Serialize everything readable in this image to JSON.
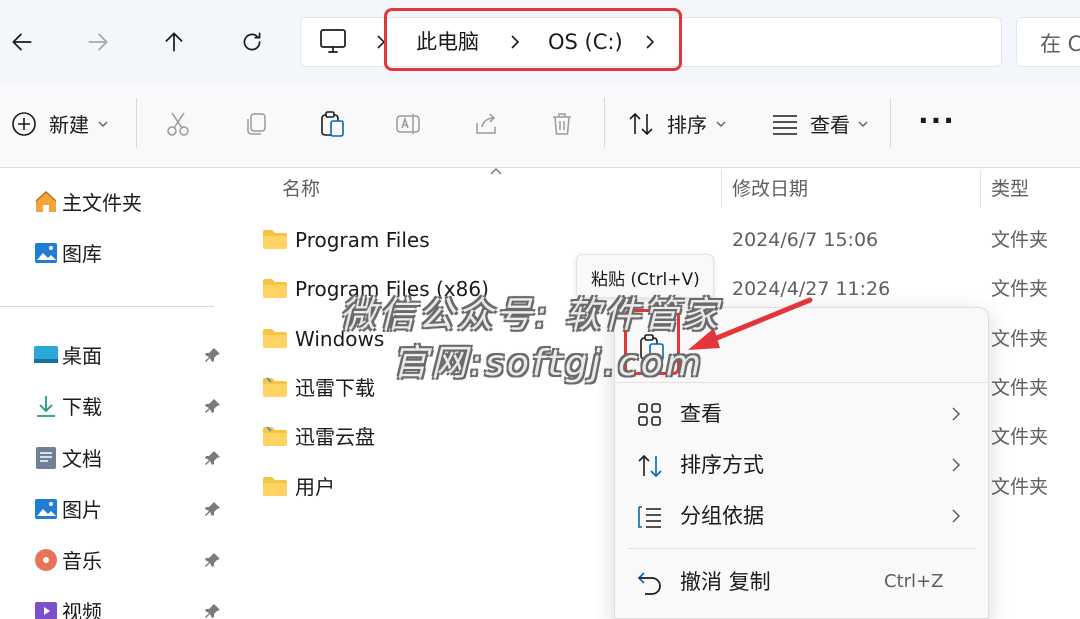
{
  "breadcrumb": {
    "items": [
      "此电脑",
      "OS (C:)"
    ]
  },
  "search": {
    "placeholder": "在 C"
  },
  "toolbar": {
    "new_label": "新建",
    "sort_label": "排序",
    "view_label": "查看"
  },
  "sidebar": {
    "items": [
      {
        "label": "主文件夹",
        "icon": "home-icon",
        "pinned": false
      },
      {
        "label": "图库",
        "icon": "gallery-icon",
        "pinned": false
      },
      {
        "label": "桌面",
        "icon": "desktop-icon",
        "pinned": true
      },
      {
        "label": "下载",
        "icon": "download-icon",
        "pinned": true
      },
      {
        "label": "文档",
        "icon": "document-icon",
        "pinned": true
      },
      {
        "label": "图片",
        "icon": "pictures-icon",
        "pinned": true
      },
      {
        "label": "音乐",
        "icon": "music-icon",
        "pinned": true
      },
      {
        "label": "视频",
        "icon": "video-icon",
        "pinned": true
      }
    ]
  },
  "columns": {
    "name": "名称",
    "date": "修改日期",
    "type": "类型"
  },
  "files": [
    {
      "name": "Program Files",
      "date": "2024/6/7 15:06",
      "type": "文件夹"
    },
    {
      "name": "Program Files (x86)",
      "date": "2024/4/27 11:26",
      "type": "文件夹"
    },
    {
      "name": "Windows",
      "date": "",
      "type": "文件夹"
    },
    {
      "name": "迅雷下载",
      "date": "",
      "type": "文件夹"
    },
    {
      "name": "迅雷云盘",
      "date": "",
      "type": "文件夹"
    },
    {
      "name": "用户",
      "date": "",
      "type": "文件夹"
    }
  ],
  "tooltip": {
    "text": "粘贴 (Ctrl+V)"
  },
  "context_menu": {
    "items": [
      {
        "label": "查看",
        "icon": "grid-icon",
        "submenu": true
      },
      {
        "label": "排序方式",
        "icon": "sort-icon",
        "submenu": true
      },
      {
        "label": "分组依据",
        "icon": "group-icon",
        "submenu": true
      },
      {
        "label": "撤消 复制",
        "icon": "undo-icon",
        "shortcut": "Ctrl+Z"
      }
    ]
  },
  "watermark": {
    "line1": "微信公众号: 软件管家",
    "line2": "官网:softgj.com"
  },
  "colors": {
    "accent": "#0067c0",
    "highlight": "#e2363a",
    "folder": "#f6c342"
  }
}
